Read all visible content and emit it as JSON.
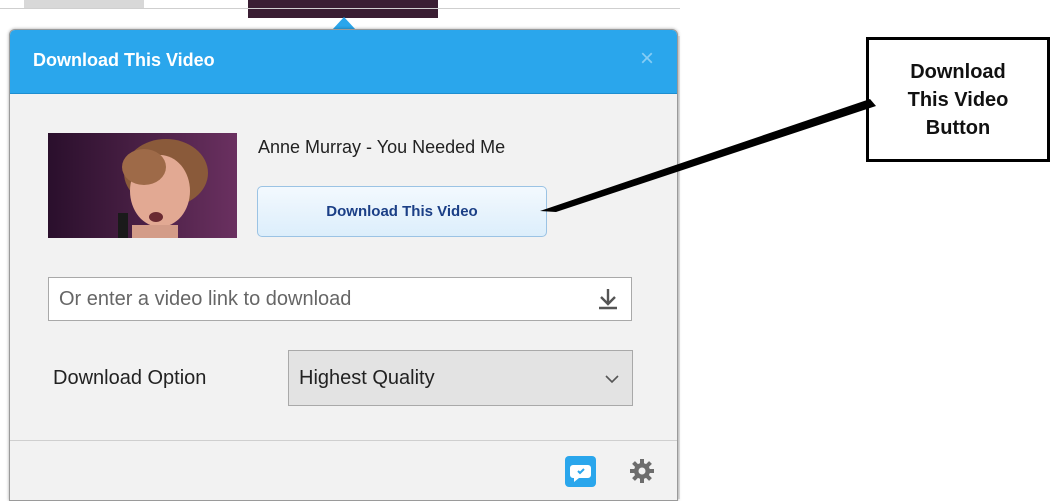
{
  "popup": {
    "title": "Download This Video",
    "close_label": "×",
    "video": {
      "title": "Anne Murray - You Needed Me"
    },
    "download_button_label": "Download This Video",
    "link_input": {
      "placeholder": "Or enter a video link to download",
      "value": ""
    },
    "download_option": {
      "label": "Download Option",
      "selected": "Highest Quality"
    }
  },
  "callout": {
    "text": "Download\nThis Video\nButton"
  },
  "colors": {
    "header": "#2aa6ec",
    "button_text": "#1b3f86",
    "callout_border": "#000000"
  },
  "icons": [
    "close-icon",
    "download-arrow-icon",
    "chevron-down-icon",
    "feedback-icon",
    "gear-icon"
  ]
}
